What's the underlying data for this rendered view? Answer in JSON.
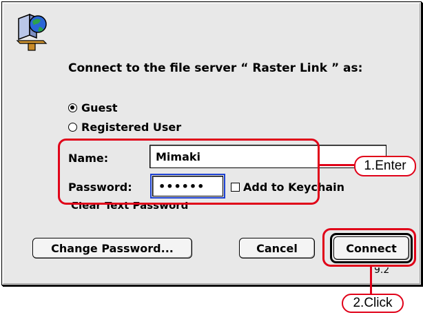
{
  "dialog": {
    "prompt": "Connect to the file server “ Raster Link ” as:",
    "version": "9.2",
    "login_options": [
      {
        "label": "Guest",
        "selected": true
      },
      {
        "label": "Registered User",
        "selected": false
      }
    ],
    "name_label": "Name:",
    "name_value": "Mimaki",
    "password_label": "Password:",
    "password_value": "••••••",
    "keychain_label": "Add to Keychain",
    "clear_text_label": "Clear Text Password",
    "buttons": {
      "change_password": "Change Password...",
      "cancel": "Cancel",
      "connect": "Connect"
    }
  },
  "annotations": {
    "enter": "1.Enter",
    "click": "2.Click",
    "color": "#e00018"
  },
  "icons": {
    "server": "file-server-icon"
  }
}
